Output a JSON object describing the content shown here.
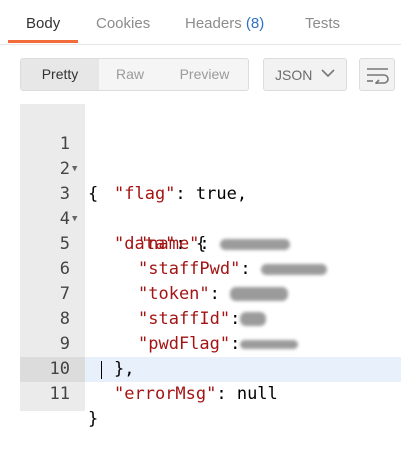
{
  "tabs": [
    {
      "label": "Body"
    },
    {
      "label": "Cookies"
    },
    {
      "label": "Headers",
      "count": "(8)"
    },
    {
      "label": "Tests"
    }
  ],
  "toolbar": {
    "view_modes": [
      "Pretty",
      "Raw",
      "Preview"
    ],
    "format": "JSON",
    "wrap_icon": "wrap-lines-icon"
  },
  "editor": {
    "line_numbers": [
      "1",
      "2",
      "3",
      "4",
      "5",
      "6",
      "7",
      "8",
      "9",
      "10",
      "11"
    ],
    "lines": {
      "l1": "{",
      "l2_key": "\"flag\"",
      "l2_rest": ": true,",
      "l3_key": "\"data\"",
      "l3_rest": ": {",
      "l4_key": "\"name\"",
      "l4_rest": ": ",
      "l5_key": "\"staffPwd\"",
      "l5_rest": ": ",
      "l6_key": "\"token\"",
      "l6_rest": ": ",
      "l7_key": "\"staffId\"",
      "l7_rest": ":",
      "l8_key": "\"pwdFlag\"",
      "l8_rest": ":",
      "l9": "},",
      "l10_key": "\"errorMsg\"",
      "l10_rest": ": null",
      "l11": "}"
    }
  },
  "colors": {
    "accent": "#f26b3a",
    "json_key": "#a31515",
    "headers_count": "#2d72c2"
  }
}
